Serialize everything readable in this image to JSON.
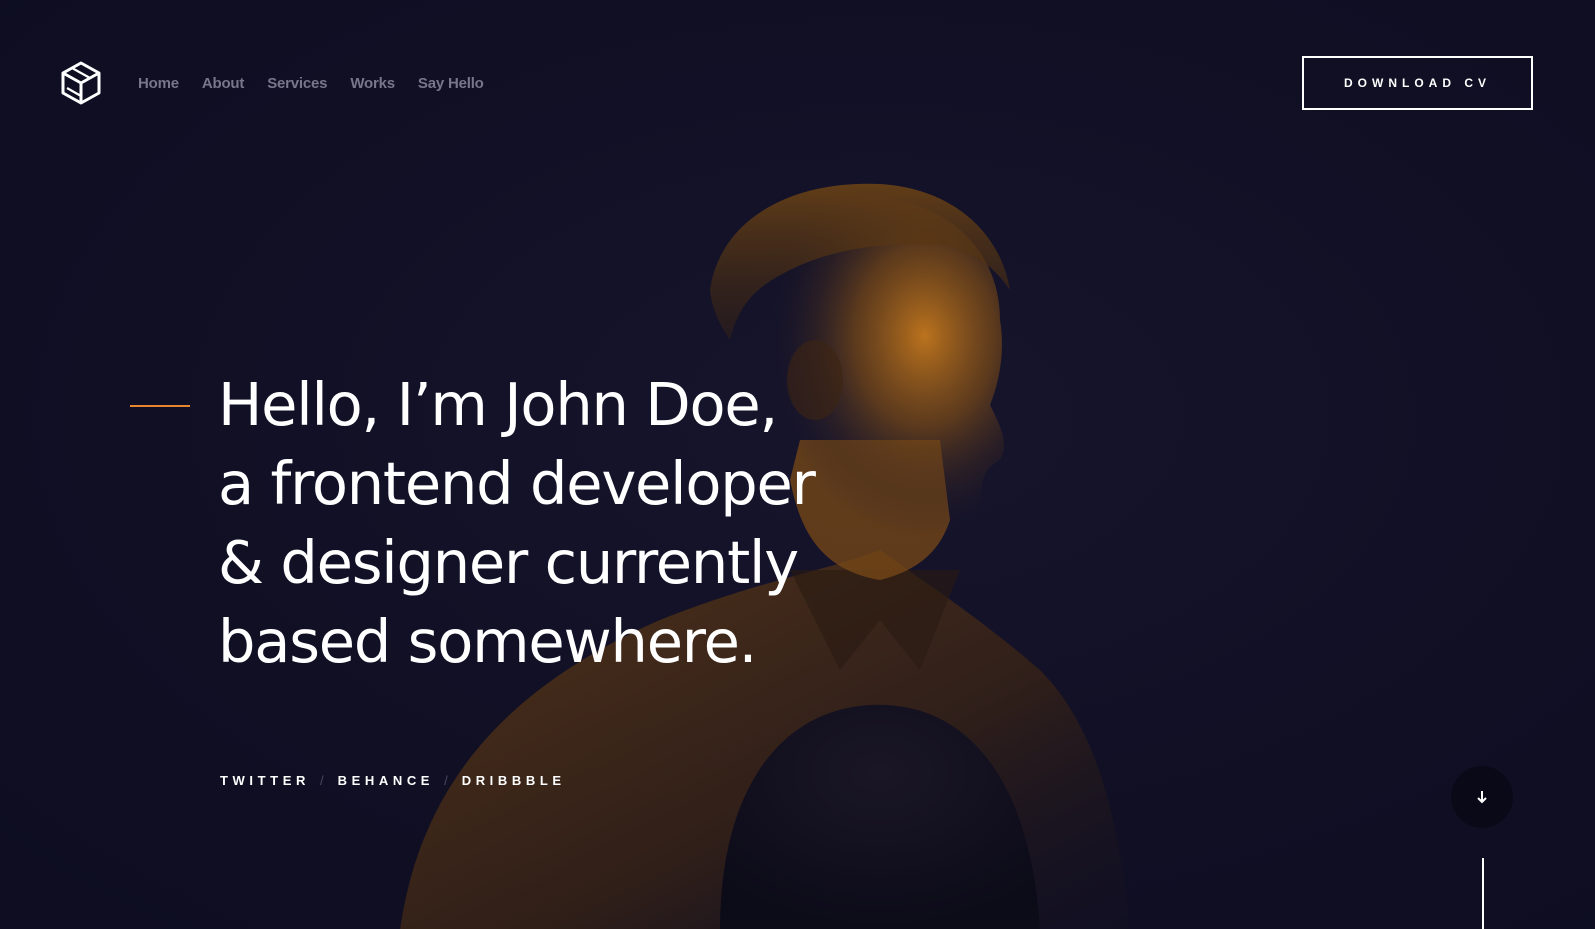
{
  "brand": {
    "logo_icon": "cube-logo-icon"
  },
  "nav": {
    "items": [
      {
        "label": "Home"
      },
      {
        "label": "About"
      },
      {
        "label": "Services"
      },
      {
        "label": "Works"
      },
      {
        "label": "Say Hello"
      }
    ]
  },
  "header": {
    "cta_label": "DOWNLOAD CV"
  },
  "hero": {
    "headline_lines": [
      "Hello, I’m John Doe,",
      "a frontend developer",
      "& designer currently",
      "based somewhere."
    ],
    "accent_color": "#e8862f",
    "background_color": "#100f24",
    "portrait_tint": "#c4781d"
  },
  "socials": {
    "items": [
      {
        "label": "TWITTER"
      },
      {
        "label": "BEHANCE"
      },
      {
        "label": "DRIBBBLE"
      }
    ],
    "separator": "/"
  },
  "scroll": {
    "icon": "arrow-down-icon"
  }
}
